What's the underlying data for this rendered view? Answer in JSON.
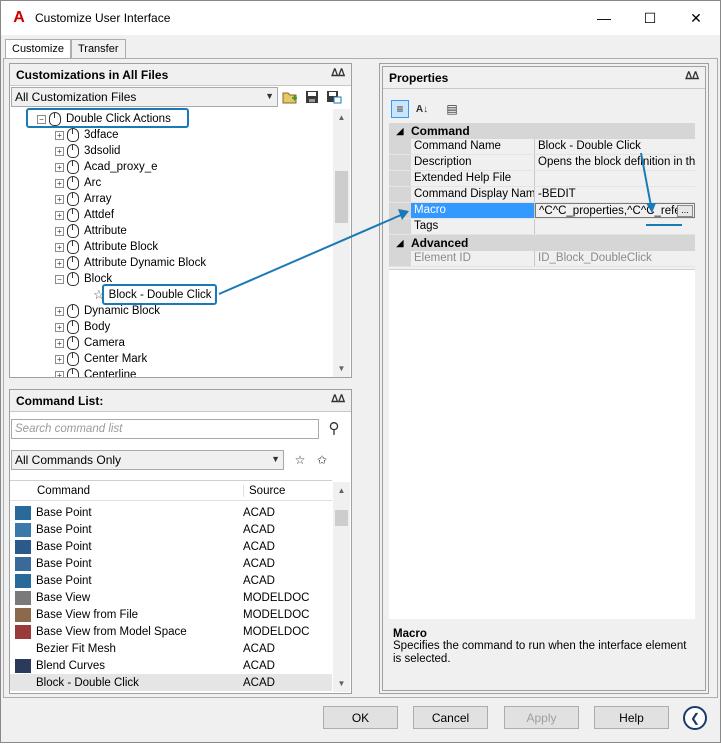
{
  "window": {
    "title": "Customize User Interface",
    "app_icon": "autocad-logo-icon"
  },
  "tabs": [
    {
      "label": "Customize"
    },
    {
      "label": "Transfer"
    }
  ],
  "customizations": {
    "header": "Customizations in All Files",
    "file_selector": "All Customization Files",
    "tree": [
      {
        "label": "Double Click Actions",
        "level": 0,
        "expanded": true
      },
      {
        "label": "3dface",
        "level": 1
      },
      {
        "label": "3dsolid",
        "level": 1
      },
      {
        "label": "Acad_proxy_e",
        "level": 1
      },
      {
        "label": "Arc",
        "level": 1
      },
      {
        "label": "Array",
        "level": 1
      },
      {
        "label": "Attdef",
        "level": 1
      },
      {
        "label": "Attribute",
        "level": 1
      },
      {
        "label": "Attribute Block",
        "level": 1
      },
      {
        "label": "Attribute Dynamic Block",
        "level": 1
      },
      {
        "label": "Block",
        "level": 1,
        "expanded": true
      },
      {
        "label": "Block - Double Click",
        "level": 2,
        "selected": true
      },
      {
        "label": "Dynamic Block",
        "level": 1
      },
      {
        "label": "Body",
        "level": 1
      },
      {
        "label": "Camera",
        "level": 1
      },
      {
        "label": "Center Mark",
        "level": 1
      },
      {
        "label": "Centerline",
        "level": 1
      }
    ]
  },
  "command_list": {
    "header": "Command List:",
    "search_placeholder": "Search command list",
    "filter": "All Commands Only",
    "columns": {
      "command": "Command",
      "source": "Source"
    },
    "rows": [
      {
        "command": "Base Point",
        "source": "ACAD"
      },
      {
        "command": "Base Point",
        "source": "ACAD"
      },
      {
        "command": "Base Point",
        "source": "ACAD"
      },
      {
        "command": "Base Point",
        "source": "ACAD"
      },
      {
        "command": "Base Point",
        "source": "ACAD"
      },
      {
        "command": "Base View",
        "source": "MODELDOC"
      },
      {
        "command": "Base View from File",
        "source": "MODELDOC"
      },
      {
        "command": "Base View from Model Space",
        "source": "MODELDOC"
      },
      {
        "command": "Bezier Fit Mesh",
        "source": "ACAD"
      },
      {
        "command": "Blend Curves",
        "source": "ACAD"
      },
      {
        "command": "Block - Double Click",
        "source": "ACAD"
      }
    ]
  },
  "properties": {
    "header": "Properties",
    "categories": [
      {
        "name": "Command",
        "rows": [
          {
            "name": "Command Name",
            "value": "Block - Double Click"
          },
          {
            "name": "Description",
            "value": "Opens the block definition in the B"
          },
          {
            "name": "Extended Help File",
            "value": ""
          },
          {
            "name": "Command Display Name",
            "value": "-BEDIT"
          },
          {
            "name": "Macro",
            "value": "^C^C_properties,^C^C_refedit",
            "selected": true
          },
          {
            "name": "Tags",
            "value": ""
          }
        ]
      },
      {
        "name": "Advanced",
        "rows": [
          {
            "name": "Element ID",
            "value": "ID_Block_DoubleClick",
            "disabled": true
          }
        ]
      }
    ],
    "browse_label": "...",
    "desc_title": "Macro",
    "desc_text": "Specifies the command to run when the interface element is selected."
  },
  "buttons": {
    "ok": "OK",
    "cancel": "Cancel",
    "apply": "Apply",
    "help": "Help"
  },
  "colors": {
    "accent": "#1a7ab8",
    "selection": "#3399ff"
  }
}
